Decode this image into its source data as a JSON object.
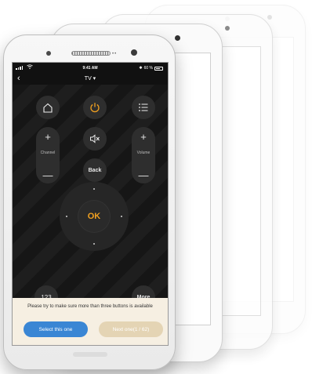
{
  "status_bar": {
    "time": "9:41 AM",
    "battery": "60 %"
  },
  "nav": {
    "back": "‹",
    "title": "TV ▾"
  },
  "remote": {
    "home_icon": "home-icon",
    "power_icon": "power-icon",
    "menu_icon": "menu-icon",
    "mute_icon": "mute-icon",
    "channel_label": "Channel",
    "volume_label": "Volume",
    "plus": "+",
    "minus": "—",
    "back_label": "Back",
    "ok_label": "OK",
    "numbers_label": "123",
    "more_label": "More"
  },
  "prompt": {
    "message": "Please try to make sure more than three buttons is available",
    "select_label": "Select this one",
    "next_label": "Next one(1 / 62)"
  },
  "colors": {
    "accent": "#f0a020",
    "primary_button": "#3a86d4",
    "secondary_button": "#e4d4b4",
    "prompt_bg": "#f6efe2"
  }
}
